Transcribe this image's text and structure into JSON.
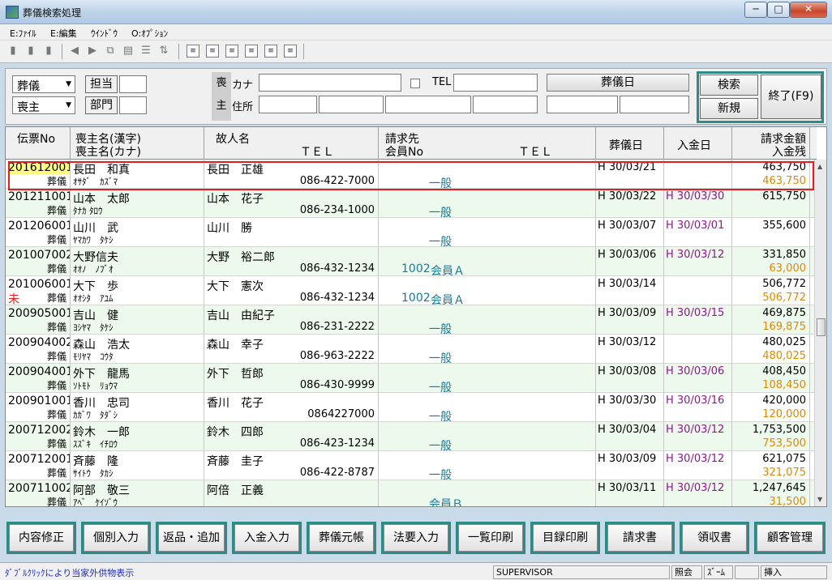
{
  "window": {
    "title": "葬儀検索処理",
    "min": "─",
    "max": "□",
    "close": "✕"
  },
  "menu": [
    "E:ﾌｧｲﾙ",
    "E:編集",
    "ｳｲﾝﾄﾞｳ",
    "O:ｵﾌﾟｼｮﾝ"
  ],
  "criteria": {
    "type_select": "葬儀",
    "role_select": "喪主",
    "tanto_label": "担当",
    "bumon_label": "部門",
    "moshu_v1": "喪",
    "moshu_v2": "主",
    "kana_label": "カナ",
    "tel_label": "TEL",
    "address_label": "住所",
    "funeral_date_label": "葬儀日",
    "search_button": "検索",
    "new_button": "新規",
    "exit_button": "終了(F9)"
  },
  "grid": {
    "headers": {
      "slip_no": "伝票No",
      "mourner_kanji": "喪主名(漢字)",
      "mourner_kana": "喪主名(カナ)",
      "deceased": "故人名",
      "tel": "ＴＥＬ",
      "bill_to": "請求先",
      "member_no": "会員No",
      "tel2": "ＴＥＬ",
      "funeral_date": "葬儀日",
      "payment_date": "入金日",
      "amount": "請求金額",
      "balance": "入金残"
    },
    "rows": [
      {
        "no": "201612001",
        "flag": "",
        "type": "葬儀",
        "kanji": "長田　和真",
        "kana": "ｵｻﾀﾞ　ｶｽﾞﾏ",
        "deceased": "長田　正雄",
        "tel": "086-422-7000",
        "member": "",
        "billto": "一般",
        "fdate": "H 30/03/21",
        "pdate": "",
        "amount": "463,750",
        "balance": "463,750"
      },
      {
        "no": "201211001",
        "flag": "",
        "type": "葬儀",
        "kanji": "山本　太郎",
        "kana": "ﾀﾅｶ ﾀﾛｳ",
        "deceased": "山本　花子",
        "tel": "086-234-1000",
        "member": "",
        "billto": "一般",
        "fdate": "H 30/03/22",
        "pdate": "H 30/03/30",
        "amount": "615,750",
        "balance": ""
      },
      {
        "no": "201206001",
        "flag": "",
        "type": "葬儀",
        "kanji": "山川　武",
        "kana": "ﾔﾏｶﾜ　ﾀｹｼ",
        "deceased": "山川　勝",
        "tel": "",
        "member": "",
        "billto": "一般",
        "fdate": "H 30/03/07",
        "pdate": "H 30/03/01",
        "amount": "355,600",
        "balance": ""
      },
      {
        "no": "201007002",
        "flag": "",
        "type": "葬儀",
        "kanji": "大野信夫",
        "kana": "ｵｵﾉ　ﾉﾌﾞｵ",
        "deceased": "大野　裕二郎",
        "tel": "086-432-1234",
        "member": "1002",
        "billto": "会員Ａ",
        "fdate": "H 30/03/06",
        "pdate": "H 30/03/12",
        "amount": "331,850",
        "balance": "63,000"
      },
      {
        "no": "201006001",
        "flag": "未",
        "type": "葬儀",
        "kanji": "大下　歩",
        "kana": "ｵｵｼﾀ　ｱﾕﾑ",
        "deceased": "大下　憲次",
        "tel": "086-432-1234",
        "member": "1002",
        "billto": "会員Ａ",
        "fdate": "H 30/03/14",
        "pdate": "",
        "amount": "506,772",
        "balance": "506,772"
      },
      {
        "no": "200905001",
        "flag": "",
        "type": "葬儀",
        "kanji": "吉山　健",
        "kana": "ﾖｼﾔﾏ　ﾀｹｼ",
        "deceased": "吉山　由紀子",
        "tel": "086-231-2222",
        "member": "",
        "billto": "一般",
        "fdate": "H 30/03/09",
        "pdate": "H 30/03/15",
        "amount": "469,875",
        "balance": "169,875"
      },
      {
        "no": "200904002",
        "flag": "",
        "type": "葬儀",
        "kanji": "森山　浩太",
        "kana": "ﾓﾘﾔﾏ　ｺｳﾀ",
        "deceased": "森山　幸子",
        "tel": "086-963-2222",
        "member": "",
        "billto": "一般",
        "fdate": "H 30/03/12",
        "pdate": "",
        "amount": "480,025",
        "balance": "480,025"
      },
      {
        "no": "200904001",
        "flag": "",
        "type": "葬儀",
        "kanji": "外下　龍馬",
        "kana": "ｿﾄﾓﾄ　ﾘｮｳﾏ",
        "deceased": "外下　哲郎",
        "tel": "086-430-9999",
        "member": "",
        "billto": "一般",
        "fdate": "H 30/03/08",
        "pdate": "H 30/03/06",
        "amount": "408,450",
        "balance": "108,450"
      },
      {
        "no": "200901001",
        "flag": "",
        "type": "葬儀",
        "kanji": "香川　忠司",
        "kana": "ｶｶﾞﾜ　ﾀﾀﾞｼ",
        "deceased": "香川　花子",
        "tel": "0864227000",
        "member": "",
        "billto": "一般",
        "fdate": "H 30/03/30",
        "pdate": "H 30/03/16",
        "amount": "420,000",
        "balance": "120,000"
      },
      {
        "no": "200712002",
        "flag": "",
        "type": "葬儀",
        "kanji": "鈴木　一郎",
        "kana": "ｽｽﾞｷ　ｲﾁﾛｳ",
        "deceased": "鈴木　四郎",
        "tel": "086-423-1234",
        "member": "",
        "billto": "一般",
        "fdate": "H 30/03/04",
        "pdate": "H 30/03/12",
        "amount": "1,753,500",
        "balance": "753,500"
      },
      {
        "no": "200712001",
        "flag": "",
        "type": "葬儀",
        "kanji": "斉藤　隆",
        "kana": "ｻｲﾄｳ　ﾀｶｼ",
        "deceased": "斉藤　圭子",
        "tel": "086-422-8787",
        "member": "",
        "billto": "一般",
        "fdate": "H 30/03/09",
        "pdate": "H 30/03/12",
        "amount": "621,075",
        "balance": "321,075"
      },
      {
        "no": "200711002",
        "flag": "",
        "type": "葬儀",
        "kanji": "阿部　敬三",
        "kana": "ｱﾍﾞ　ｹｲｿﾞｳ",
        "deceased": "阿倍　正義",
        "tel": "",
        "member": "",
        "billto": "会員Ｂ",
        "fdate": "H 30/03/11",
        "pdate": "H 30/03/12",
        "amount": "1,247,645",
        "balance": "31,500"
      }
    ]
  },
  "buttons": [
    "内容修正",
    "個別入力",
    "返品・追加",
    "入金入力",
    "葬儀元帳",
    "法要入力",
    "一覧印刷",
    "目録印刷",
    "請求書",
    "領収書",
    "顧客管理"
  ],
  "status": {
    "hint": "ﾀﾞﾌﾞﾙｸﾘｯｸにより当家外供物表示",
    "user": "SUPERVISOR",
    "mode": "照会",
    "zoom": "ｽﾞｰﾑ",
    "insert": "挿入"
  },
  "colors": {
    "teal_frame": "#2d8a85",
    "row_alt": "#ecf9ec",
    "selected_no_bg": "#ffff80",
    "payment_date": "#8b1a8b",
    "balance": "#e08a00",
    "billto": "#1a7a9a",
    "flag": "#e02020",
    "status_hint": "#1b2fbf"
  }
}
